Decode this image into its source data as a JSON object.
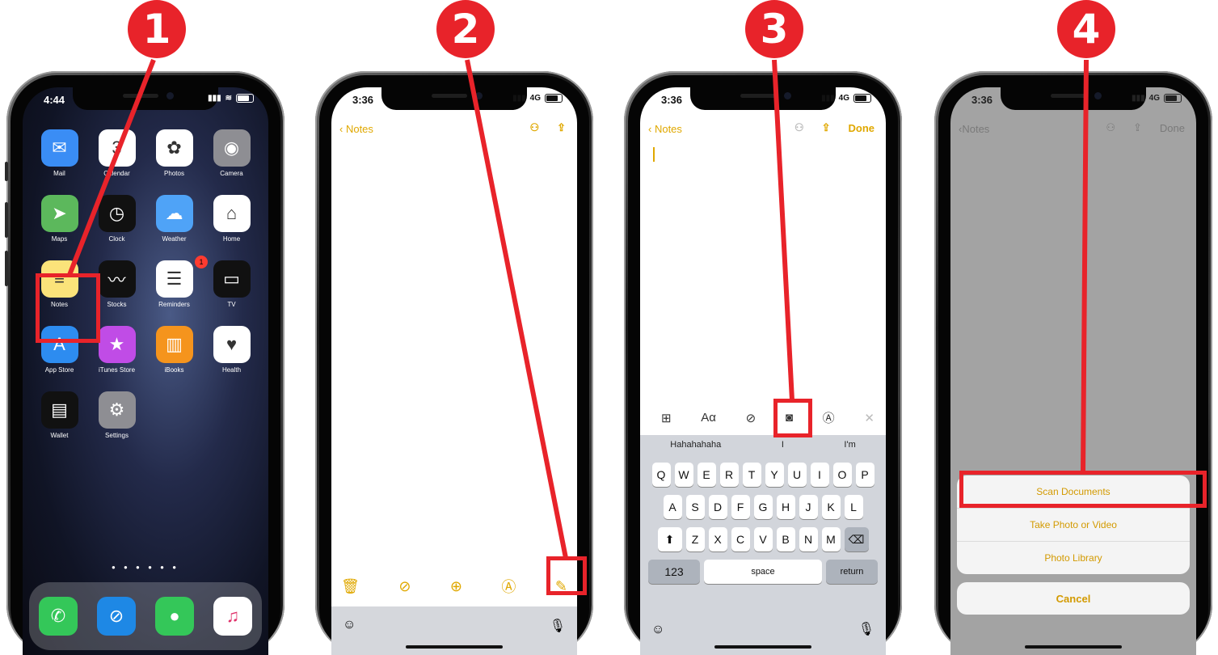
{
  "steps": [
    "1",
    "2",
    "3",
    "4"
  ],
  "colors": {
    "accent": "#e8232a",
    "notes_yellow": "#e0a800"
  },
  "panel1": {
    "time": "4:44",
    "apps": [
      {
        "label": "Mail",
        "icon": "mail-icon",
        "glyph": "✉",
        "color": "#3a8df5"
      },
      {
        "label": "Calendar",
        "icon": "calendar-icon",
        "glyph": "3",
        "color": "#ffffff",
        "day": "Tuesday"
      },
      {
        "label": "Photos",
        "icon": "photos-icon",
        "glyph": "✿",
        "color": "#ffffff"
      },
      {
        "label": "Camera",
        "icon": "camera-icon",
        "glyph": "◉",
        "color": "#8e8e93"
      },
      {
        "label": "Maps",
        "icon": "maps-icon",
        "glyph": "➤",
        "color": "#5cb85c"
      },
      {
        "label": "Clock",
        "icon": "clock-icon",
        "glyph": "◷",
        "color": "#111111"
      },
      {
        "label": "Weather",
        "icon": "weather-icon",
        "glyph": "☁",
        "color": "#4fa3f7"
      },
      {
        "label": "Home",
        "icon": "home-icon",
        "glyph": "⌂",
        "color": "#ffffff"
      },
      {
        "label": "Notes",
        "icon": "notes-icon",
        "glyph": "≡",
        "color": "#fbe37a"
      },
      {
        "label": "Stocks",
        "icon": "stocks-icon",
        "glyph": "〰",
        "color": "#111111"
      },
      {
        "label": "Reminders",
        "icon": "reminders-icon",
        "glyph": "☰",
        "color": "#ffffff",
        "badge": "1"
      },
      {
        "label": "TV",
        "icon": "tv-icon",
        "glyph": "▭",
        "color": "#111111"
      },
      {
        "label": "App Store",
        "icon": "app-store-icon",
        "glyph": "A",
        "color": "#2d8cf0"
      },
      {
        "label": "iTunes Store",
        "icon": "itunes-store-icon",
        "glyph": "★",
        "color": "#c04ce6"
      },
      {
        "label": "iBooks",
        "icon": "ibooks-icon",
        "glyph": "▥",
        "color": "#f5941d"
      },
      {
        "label": "Health",
        "icon": "health-icon",
        "glyph": "♥",
        "color": "#ffffff"
      },
      {
        "label": "Wallet",
        "icon": "wallet-icon",
        "glyph": "▤",
        "color": "#111111"
      },
      {
        "label": "Settings",
        "icon": "settings-icon",
        "glyph": "⚙",
        "color": "#8e8e93"
      }
    ],
    "dock": [
      {
        "icon": "phone-icon",
        "glyph": "✆",
        "color": "#34c759"
      },
      {
        "icon": "safari-icon",
        "glyph": "⊘",
        "color": "#1e88e5"
      },
      {
        "icon": "messages-icon",
        "glyph": "●",
        "color": "#34c759"
      },
      {
        "icon": "music-icon",
        "glyph": "♫",
        "color": "#ffffff"
      }
    ]
  },
  "panel2": {
    "time": "3:36",
    "signal": "4G",
    "back": "Notes",
    "toolbar_icons": [
      "trash-icon",
      "checklist-icon",
      "add-icon",
      "markup-icon",
      "compose-icon"
    ]
  },
  "panel3": {
    "time": "3:36",
    "signal": "4G",
    "back": "Notes",
    "done": "Done",
    "suggestions": [
      "Hahahahaha",
      "I",
      "I'm"
    ],
    "rows": [
      [
        "Q",
        "W",
        "E",
        "R",
        "T",
        "Y",
        "U",
        "I",
        "O",
        "P"
      ],
      [
        "A",
        "S",
        "D",
        "F",
        "G",
        "H",
        "J",
        "K",
        "L"
      ],
      [
        "Z",
        "X",
        "C",
        "V",
        "B",
        "N",
        "M"
      ]
    ],
    "num": "123",
    "space": "space",
    "return": "return",
    "format": "Aα"
  },
  "panel4": {
    "time": "3:36",
    "signal": "4G",
    "back": "Notes",
    "done": "Done",
    "options": [
      "Scan Documents",
      "Take Photo or Video",
      "Photo Library"
    ],
    "cancel": "Cancel"
  }
}
